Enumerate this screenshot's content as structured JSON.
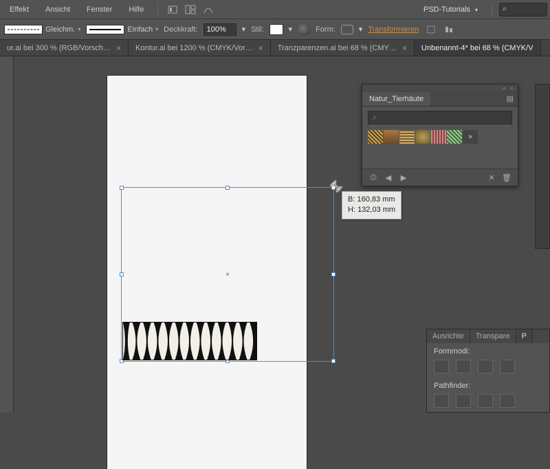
{
  "menu": {
    "effekt": "Effekt",
    "ansicht": "Ansicht",
    "fenster": "Fenster",
    "hilfe": "Hilfe"
  },
  "header": {
    "psd_label": "PSD-Tutorials"
  },
  "search": {
    "glyph": "⌕"
  },
  "options": {
    "dash_label": "Gleichm.",
    "solid_label": "Einfach",
    "opacity_label": "Deckkraft:",
    "opacity_value": "100%",
    "style_label": "Stil:",
    "shape_label": "Form:",
    "transform_link": "Transformieren"
  },
  "tabs": [
    {
      "label": "ur.ai bei 300 % (RGB/Vorsch…",
      "active": false
    },
    {
      "label": "Kontur.ai bei 1200 % (CMYK/Vor…",
      "active": false
    },
    {
      "label": "Tranzparenzen.ai bei 68 % (CMY…",
      "active": false
    },
    {
      "label": "Unbenannt-4* bei 68 % (CMYK/V",
      "active": true
    }
  ],
  "tooltip": {
    "w_label": "B:",
    "w_value": "160,83 mm",
    "h_label": "H:",
    "h_value": "132,03 mm"
  },
  "swatch_panel": {
    "title": "Natur_Tierhäute",
    "menu_glyph": "▤",
    "collapse": "«",
    "close": "×",
    "search_glyph": "⌕",
    "more_glyph": "»",
    "footer": {
      "i1": "⎙",
      "i2": "◀",
      "i3": "▶",
      "trash_sep": "✕",
      "trash": "🗑"
    }
  },
  "dock2": {
    "tab1": "Ausrichte",
    "tab2": "Transpare",
    "tab3": "P",
    "section1_label": "Formmodi:",
    "section2_label": "Pathfinder:"
  }
}
